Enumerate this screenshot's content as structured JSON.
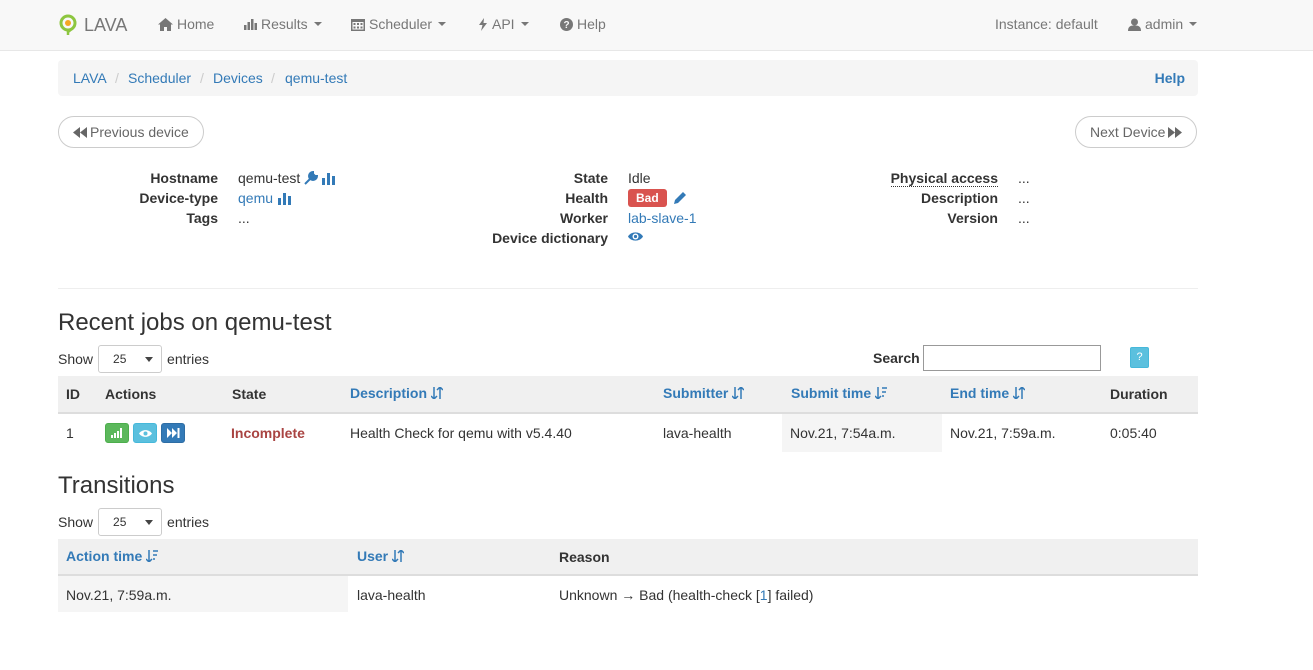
{
  "navbar": {
    "brand": "LAVA",
    "home": "Home",
    "results": "Results",
    "scheduler": "Scheduler",
    "api": "API",
    "help": "Help",
    "instance": "Instance: default",
    "user": "admin"
  },
  "breadcrumb": {
    "items": [
      "LAVA",
      "Scheduler",
      "Devices",
      "qemu-test"
    ],
    "help": "Help"
  },
  "pager": {
    "previous": "Previous device",
    "next": "Next Device"
  },
  "device": {
    "hostname_label": "Hostname",
    "hostname": "qemu-test",
    "device_type_label": "Device-type",
    "device_type": "qemu",
    "tags_label": "Tags",
    "tags": "...",
    "state_label": "State",
    "state": "Idle",
    "health_label": "Health",
    "health": "Bad",
    "worker_label": "Worker",
    "worker": "lab-slave-1",
    "device_dict_label": "Device dictionary",
    "physical_access_label": "Physical access",
    "physical_access": "...",
    "description_label": "Description",
    "description": "...",
    "version_label": "Version",
    "version": "..."
  },
  "jobs": {
    "title": "Recent jobs on qemu-test",
    "show": "Show",
    "entries": "entries",
    "page_size": "25",
    "search_label": "Search",
    "search_value": "",
    "help_button": "?",
    "columns": [
      "ID",
      "Actions",
      "State",
      "Description",
      "Submitter",
      "Submit time",
      "End time",
      "Duration"
    ],
    "rows": [
      {
        "id": "1",
        "state": "Incomplete",
        "description": "Health Check for qemu with v5.4.40",
        "submitter": "lava-health",
        "submit_time": "Nov.21, 7:54a.m.",
        "end_time": "Nov.21, 7:59a.m.",
        "duration": "0:05:40"
      }
    ]
  },
  "transitions": {
    "title": "Transitions",
    "show": "Show",
    "entries": "entries",
    "page_size": "25",
    "columns": [
      "Action time",
      "User",
      "Reason"
    ],
    "rows": [
      {
        "action_time": "Nov.21, 7:59a.m.",
        "user": "lava-health",
        "reason_prefix": "Unknown → Bad (health-check [",
        "reason_link": "1",
        "reason_suffix": "] failed)"
      }
    ]
  },
  "colors": {
    "link": "#337ab7",
    "danger": "#d9534f",
    "incomplete": "#a94442",
    "success": "#5cb85c",
    "info": "#5bc0de"
  }
}
